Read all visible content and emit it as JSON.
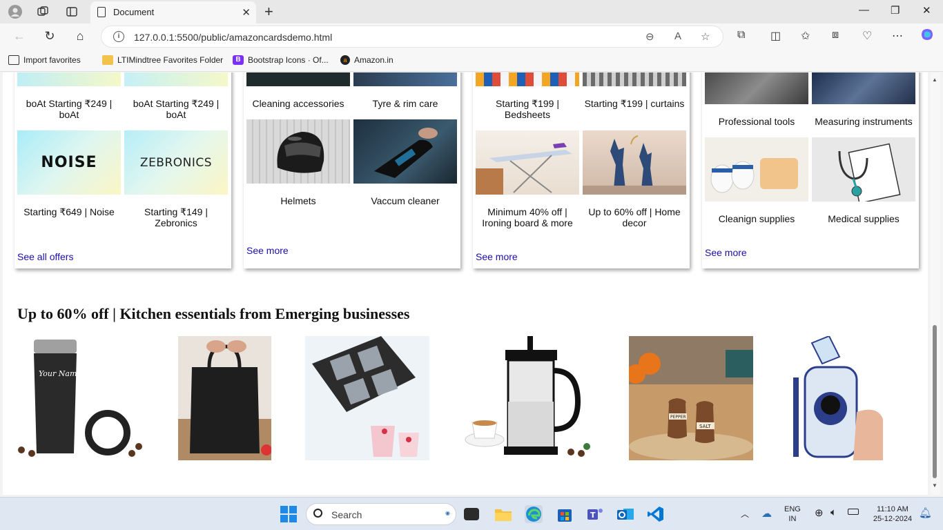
{
  "browser": {
    "tab_title": "Document",
    "url": "127.0.0.1:5500/public/amazoncardsdemo.html",
    "favorites": [
      "Import favorites",
      "LTIMindtree Favorites Folder",
      "Bootstrap Icons · Of...",
      "Amazon.in"
    ]
  },
  "cards": [
    {
      "tiles": [
        {
          "caption": "boAt Starting ₹249 | boAt"
        },
        {
          "caption": "boAt Starting ₹249 | boAt"
        },
        {
          "caption": "Starting ₹649 | Noise",
          "brand": "NOISE"
        },
        {
          "caption": "Starting ₹149 | Zebronics",
          "brand": "ZEBRONICS"
        }
      ],
      "link": "See all offers"
    },
    {
      "tiles": [
        {
          "caption": "Cleaning accessories"
        },
        {
          "caption": "Tyre & rim care"
        },
        {
          "caption": "Helmets"
        },
        {
          "caption": "Vaccum cleaner"
        }
      ],
      "link": "See more"
    },
    {
      "tiles": [
        {
          "caption": "Starting ₹199 | Bedsheets"
        },
        {
          "caption": "Starting ₹199 | curtains"
        },
        {
          "caption": "Minimum 40% off | Ironing board & more"
        },
        {
          "caption": "Up to 60% off | Home decor"
        }
      ],
      "link": "See more"
    },
    {
      "tiles": [
        {
          "caption": "Professional tools"
        },
        {
          "caption": "Measuring instruments"
        },
        {
          "caption": "Cleanign supplies"
        },
        {
          "caption": "Medical supplies"
        }
      ],
      "link": "See more"
    }
  ],
  "section": {
    "title": "Up to 60% off | Kitchen essentials from Emerging businesses",
    "products": [
      "travel-mug",
      "lunch-bag",
      "ice-cube-tray",
      "french-press",
      "salt-pepper-jars",
      "kids-water-bottle"
    ],
    "mug_text": "Your Name",
    "jar_labels": [
      "PEPPER",
      "SALT"
    ]
  },
  "taskbar": {
    "search_placeholder": "Search",
    "lang": "ENG",
    "region": "IN",
    "time": "11:10 AM",
    "date": "25-12-2024"
  }
}
